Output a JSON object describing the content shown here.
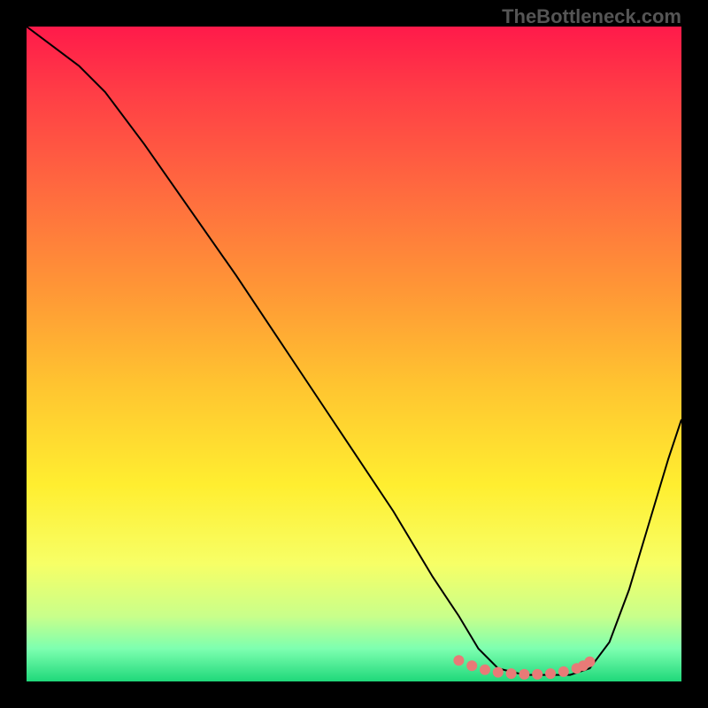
{
  "watermark": "TheBottleneck.com",
  "chart_data": {
    "type": "line",
    "title": "",
    "xlabel": "",
    "ylabel": "",
    "xlim": [
      0,
      100
    ],
    "ylim": [
      0,
      100
    ],
    "gradient_stops": [
      {
        "offset": 0,
        "color": "#ff1a4a"
      },
      {
        "offset": 10,
        "color": "#ff3d46"
      },
      {
        "offset": 25,
        "color": "#ff6a3f"
      },
      {
        "offset": 40,
        "color": "#ff9636"
      },
      {
        "offset": 55,
        "color": "#ffc530"
      },
      {
        "offset": 70,
        "color": "#ffee30"
      },
      {
        "offset": 82,
        "color": "#f7ff66"
      },
      {
        "offset": 90,
        "color": "#c9ff8a"
      },
      {
        "offset": 95,
        "color": "#7dffb0"
      },
      {
        "offset": 100,
        "color": "#1fd87a"
      }
    ],
    "series": [
      {
        "name": "bottleneck-curve",
        "color": "#000000",
        "stroke_width": 2,
        "x": [
          0,
          4,
          8,
          12,
          18,
          25,
          32,
          40,
          48,
          56,
          62,
          66,
          69,
          72,
          76,
          80,
          83,
          86,
          89,
          92,
          95,
          98,
          100
        ],
        "y": [
          100,
          97,
          94,
          90,
          82,
          72,
          62,
          50,
          38,
          26,
          16,
          10,
          5,
          2,
          1,
          1,
          1,
          2,
          6,
          14,
          24,
          34,
          40
        ]
      },
      {
        "name": "optimum-markers",
        "color": "#e87a77",
        "type": "scatter",
        "marker_size": 6,
        "x": [
          66,
          68,
          70,
          72,
          74,
          76,
          78,
          80,
          82,
          84,
          85,
          86
        ],
        "y": [
          3.2,
          2.4,
          1.8,
          1.4,
          1.2,
          1.1,
          1.1,
          1.2,
          1.5,
          2.0,
          2.4,
          3.0
        ]
      }
    ]
  }
}
